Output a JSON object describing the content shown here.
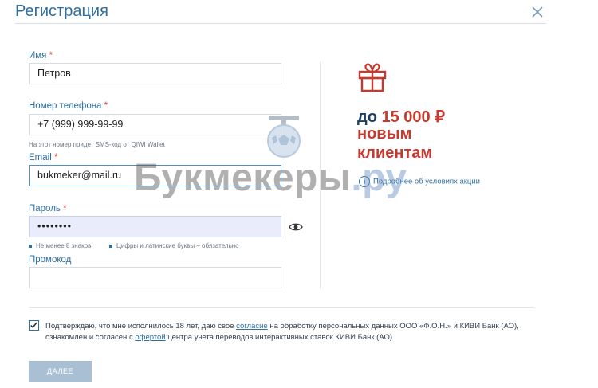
{
  "dialog": {
    "title": "Регистрация"
  },
  "form": {
    "name": {
      "label": "Имя",
      "required": "*",
      "value": "Петров"
    },
    "phone": {
      "label": "Номер телефона",
      "required": "*",
      "value": "+7 (999) 999-99-99",
      "hint": "На этот номер придет SMS-код от QIWI Wallet"
    },
    "email": {
      "label": "Email",
      "required": "*",
      "value": "bukmeker@mail.ru"
    },
    "password": {
      "label": "Пароль",
      "required": "*",
      "value": "••••••••",
      "rules": [
        "Не менее 8 знаков",
        "Цифры и латинские буквы – обязательно"
      ]
    },
    "promo": {
      "label": "Промокод",
      "value": ""
    }
  },
  "promo_banner": {
    "prefix": "до",
    "amount": "15 000 ₽",
    "line2": "новым",
    "line3": "клиентам",
    "more_link": "Подробнее об условиях акции",
    "info_glyph": "i"
  },
  "consent": {
    "checked": true,
    "text_1": "Подтверждаю, что мне исполнилось 18 лет, даю свое ",
    "link_1": "согласие",
    "text_2": " на обработку персональных данных ООО «Ф.О.Н.» и КИВИ Банк (АО), ознакомлен и согласен с ",
    "link_2": "офертой",
    "text_3": " центра учета переводов интерактивных ставок КИВИ Банк (АО)"
  },
  "submit": {
    "label": "ДАЛЕЕ"
  },
  "watermark": {
    "main": "Букмекеры",
    "suffix": ".ру"
  },
  "colors": {
    "accent": "#2e6fa2",
    "promo_red": "#c6392f",
    "promo_navy": "#1e3c60",
    "button_disabled": "#a9bfd3",
    "password_fill": "#e8ecfb"
  },
  "icons": {
    "close": "close-icon",
    "gift": "gift-icon",
    "eye": "eye-icon",
    "info": "info-icon",
    "check": "checkmark-icon"
  }
}
